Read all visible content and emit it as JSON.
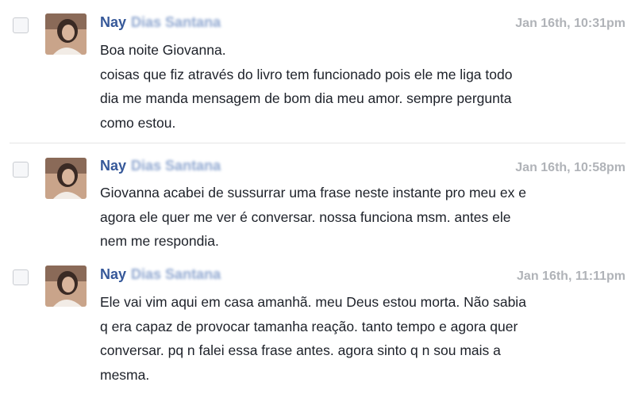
{
  "messages": [
    {
      "sender_first": "Nay",
      "sender_last": "Dias Santana",
      "timestamp": "Jan 16th, 10:31pm",
      "lines": [
        "Boa noite Giovanna.",
        "coisas que fiz através do livro tem funcionado pois ele me liga todo",
        "dia me manda mensagem  de bom dia meu amor. sempre pergunta",
        "como estou."
      ]
    },
    {
      "sender_first": "Nay",
      "sender_last": "Dias Santana",
      "timestamp": "Jan 16th, 10:58pm",
      "lines": [
        "Giovanna acabei de sussurrar uma frase neste instante pro meu ex e",
        "agora ele quer me ver é conversar. nossa funciona msm. antes ele",
        "nem me respondia."
      ]
    },
    {
      "sender_first": "Nay",
      "sender_last": "Dias Santana",
      "timestamp": "Jan 16th, 11:11pm",
      "lines": [
        "Ele vai vim aqui em casa amanhã. meu Deus estou morta. Não sabia",
        "q era capaz de provocar tamanha reação. tanto tempo e agora quer",
        "conversar. pq n falei essa frase antes. agora sinto q n sou mais a",
        "mesma."
      ]
    }
  ],
  "icons": {
    "checkbox": "checkbox-icon",
    "avatar": "avatar-photo"
  },
  "colors": {
    "sender": "#365899",
    "timestamp": "#b0b3b8",
    "text": "#1d2129",
    "divider": "#e5e5e5"
  }
}
